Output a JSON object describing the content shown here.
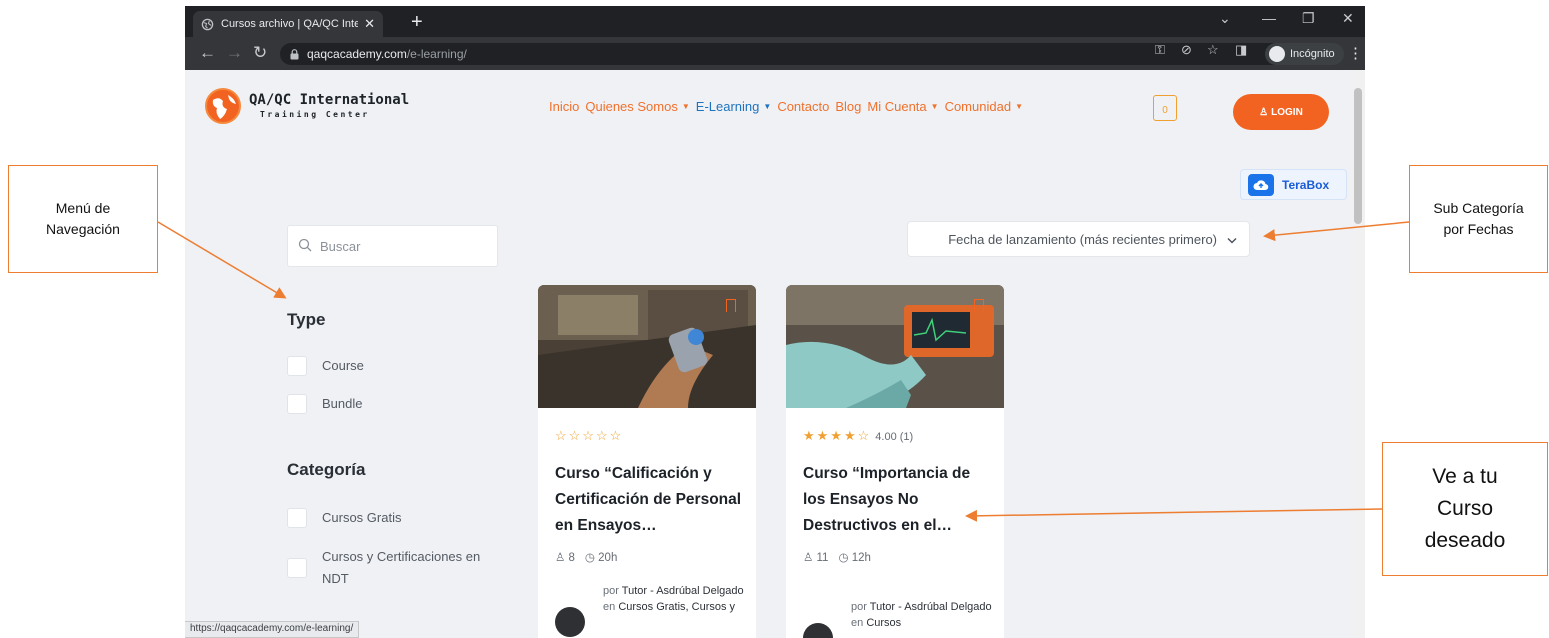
{
  "browser": {
    "tab_title": "Cursos archivo | QA/QC Internati",
    "url_host": "qaqcacademy.com",
    "url_path": "/e-learning/",
    "incognito_label": "Incógnito",
    "status_url": "https://qaqcacademy.com/e-learning/"
  },
  "site": {
    "logo_line1": "QA/QC International",
    "logo_line2": "Training Center",
    "nav": [
      {
        "label": "Inicio",
        "has_caret": false
      },
      {
        "label": "Quienes Somos",
        "has_caret": true
      },
      {
        "label": "E-Learning",
        "has_caret": true,
        "active": true
      },
      {
        "label": "Contacto",
        "has_caret": false
      },
      {
        "label": "Blog",
        "has_caret": false
      },
      {
        "label": "Mi Cuenta",
        "has_caret": true
      },
      {
        "label": "Comunidad",
        "has_caret": true
      }
    ],
    "cart_count": "0",
    "login_label": "LOGIN",
    "terabox_label": "TeraBox"
  },
  "filters": {
    "search_placeholder": "Buscar",
    "sort_selected": "Fecha de lanzamiento (más recientes primero)",
    "type_heading": "Type",
    "type_options": [
      "Course",
      "Bundle"
    ],
    "category_heading": "Categoría",
    "category_options": [
      "Cursos Gratis",
      "Cursos y Certificaciones en NDT"
    ]
  },
  "courses": [
    {
      "rating": 0,
      "rating_label": "",
      "title": "Curso “Calificación y Certificación de Personal en Ensayos…",
      "students": "8",
      "duration": "20h",
      "author_by": "por",
      "author": "Tutor - Asdrúbal Delgado",
      "in": "en",
      "categories": "Cursos Gratis, Cursos y"
    },
    {
      "rating": 4,
      "rating_label": "4.00 (1)",
      "title": "Curso “Importancia de los Ensayos No Destructivos en el…",
      "students": "11",
      "duration": "12h",
      "author_by": "por",
      "author": "Tutor - Asdrúbal Delgado",
      "in": "en",
      "categories": "Cursos"
    }
  ],
  "annotations": {
    "nav_menu": "Menú de Navegación",
    "sub_category": "Sub Categoría por Fechas",
    "go_course": "Ve a tu Curso deseado"
  },
  "colors": {
    "accent": "#f26322",
    "annotation_border": "#ed7d31",
    "active_nav": "#1e73be",
    "stars": "#f0a030"
  }
}
